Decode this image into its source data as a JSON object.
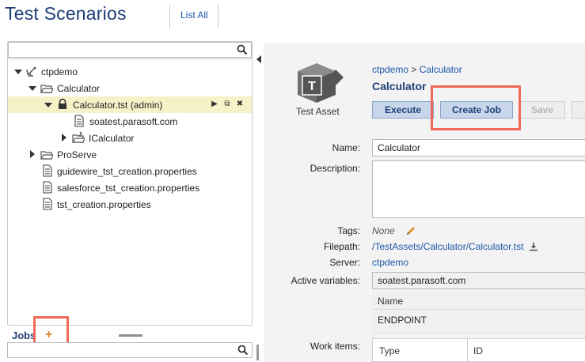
{
  "header": {
    "title": "Test Scenarios",
    "list_all_label": "List All"
  },
  "tree": {
    "items": [
      {
        "label": "ctpdemo",
        "icon": "satellite-dish-icon"
      },
      {
        "label": "Calculator",
        "icon": "folder-open-icon"
      },
      {
        "label": "Calculator.tst (admin)",
        "icon": "lock-icon"
      },
      {
        "label": "soatest.parasoft.com",
        "icon": "document-icon"
      },
      {
        "label": "ICalculator",
        "icon": "folder-plug-icon"
      },
      {
        "label": "ProServe",
        "icon": "folder-open-icon"
      },
      {
        "label": "guidewire_tst_creation.properties",
        "icon": "document-icon"
      },
      {
        "label": "salesforce_tst_creation.properties",
        "icon": "document-icon"
      },
      {
        "label": "tst_creation.properties",
        "icon": "document-icon"
      }
    ]
  },
  "jobs": {
    "label": "Jobs",
    "add_label": "+"
  },
  "detail": {
    "asset_caption": "Test Asset",
    "breadcrumb_parent": "ctpdemo",
    "breadcrumb_sep": ">",
    "breadcrumb_current": "Calculator",
    "title": "Calculator",
    "buttons": {
      "execute": "Execute",
      "create_job": "Create Job",
      "save": "Save"
    },
    "fields": {
      "name_label": "Name:",
      "name_value": "Calculator",
      "description_label": "Description:",
      "description_value": "",
      "tags_label": "Tags:",
      "tags_value": "None",
      "filepath_label": "Filepath:",
      "filepath_value": "/TestAssets/Calculator/Calculator.tst",
      "server_label": "Server:",
      "server_value": "ctpdemo",
      "active_variables_label": "Active variables:",
      "active_variables_value": "soatest.parasoft.com",
      "variables_table_header": "Name",
      "variables_table_value": "ENDPOINT",
      "work_items_label": "Work items:",
      "work_items_col_type": "Type",
      "work_items_col_id": "ID"
    }
  },
  "colors": {
    "title": "#1f3f77",
    "link": "#1e56a8",
    "selected_row": "#f7f1c8",
    "highlight_box": "#f0685a",
    "button_bg": "#c7d6ea",
    "add_icon": "#d9822b"
  }
}
